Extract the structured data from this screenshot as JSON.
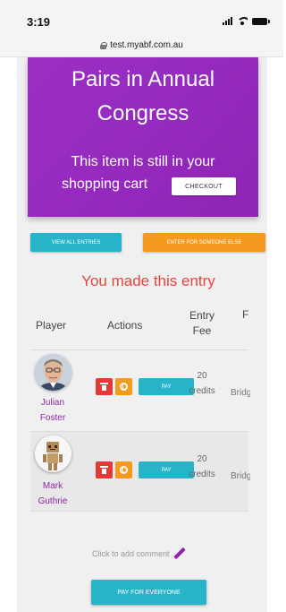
{
  "status_bar": {
    "time": "3:19"
  },
  "browser": {
    "url": "test.myabf.com.au"
  },
  "banner": {
    "title_line1": "Pairs in Annual",
    "title_line2": "Congress",
    "subtitle_line1": "This item is still in your",
    "subtitle_line2": "shopping cart",
    "checkout_label": "CHECKOUT",
    "color": "#9c2fc5"
  },
  "buttons": {
    "view_all_entries": "VIEW ALL ENTRIES",
    "enter_for_someone_else": "ENTER FOR SOMEONE ELSE",
    "pay_for_everyone": "PAY FOR EVERYONE",
    "pay": "PAY"
  },
  "message": "You made this entry",
  "table": {
    "headers": {
      "player": "Player",
      "actions": "Actions",
      "entry_fee_line1": "Entry",
      "entry_fee_line2": "Fee",
      "event_cut": "F"
    },
    "rows": [
      {
        "first": "Julian",
        "last": "Foster",
        "fee": "20",
        "fee_unit": "credits",
        "event": "Bridg"
      },
      {
        "first": "Mark",
        "last": "Guthrie",
        "fee": "20",
        "fee_unit": "credits",
        "event": "Bridg"
      }
    ]
  },
  "comment_prompt": "Click to add comment",
  "colors": {
    "accent_purple": "#8e24aa",
    "teal": "#27b4c9",
    "orange": "#f59a1f",
    "red": "#e53935",
    "message_red": "#e8453c"
  },
  "icons": [
    "signal-icon",
    "wifi-icon",
    "battery-icon",
    "lock-icon",
    "trash-icon",
    "coin-icon",
    "pencil-icon"
  ]
}
